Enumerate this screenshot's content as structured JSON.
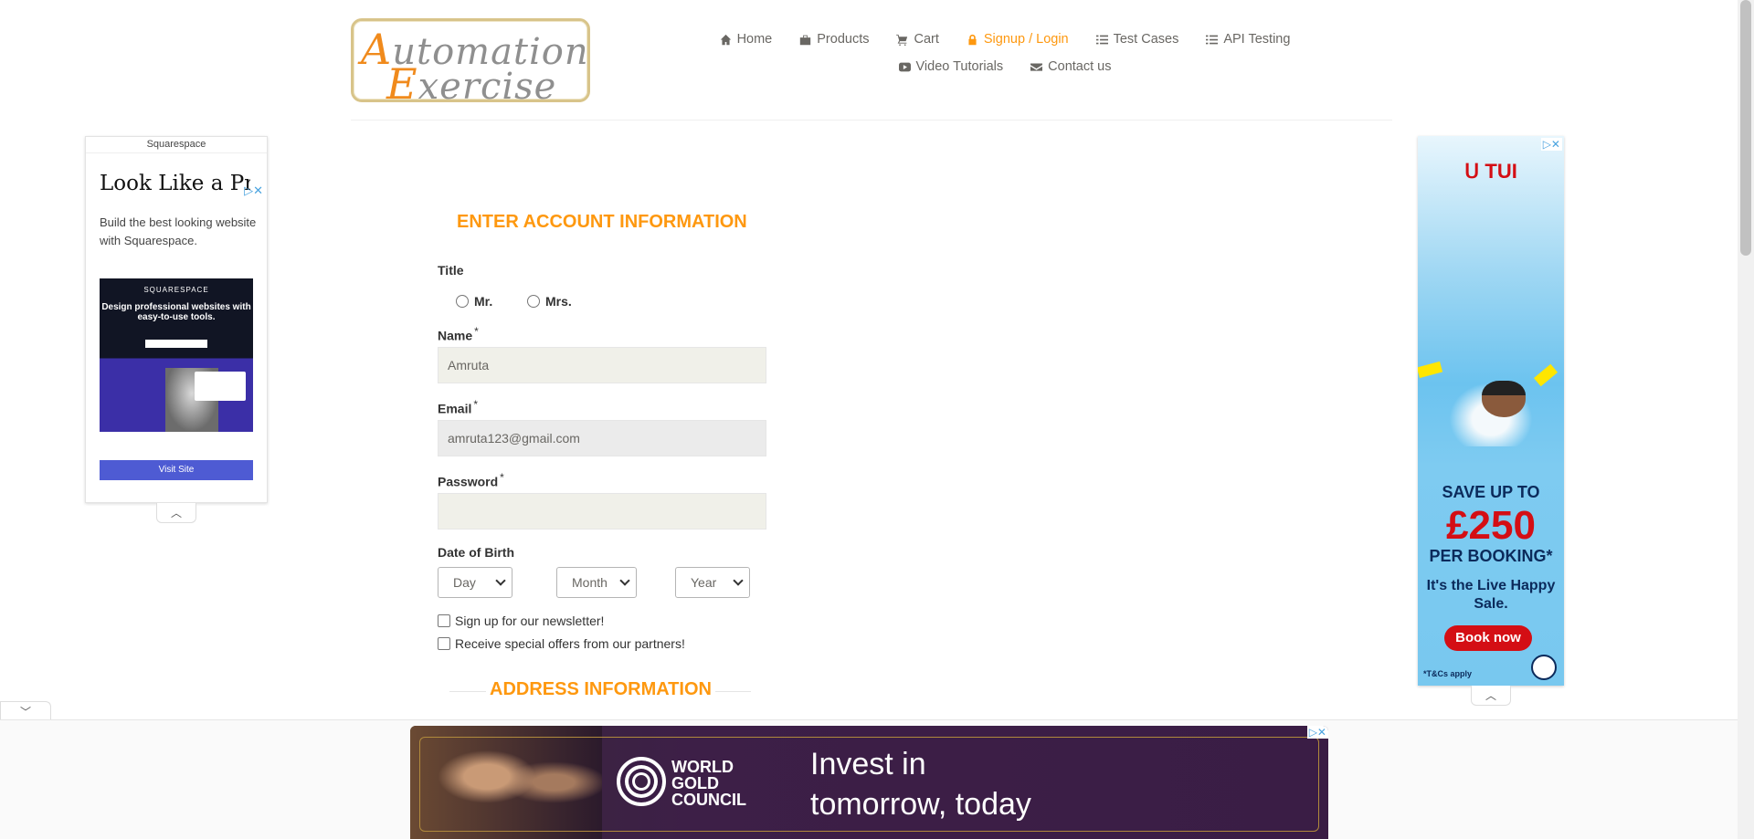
{
  "logo": {
    "line1": "Automation",
    "line2": "Exercise"
  },
  "nav": {
    "row1": [
      {
        "label": "Home",
        "icon": "home-icon"
      },
      {
        "label": "Products",
        "icon": "products-icon"
      },
      {
        "label": "Cart",
        "icon": "cart-icon"
      },
      {
        "label": "Signup / Login",
        "icon": "lock-icon",
        "active": true
      },
      {
        "label": "Test Cases",
        "icon": "list-icon"
      },
      {
        "label": "API Testing",
        "icon": "list-icon"
      }
    ],
    "row2": [
      {
        "label": "Video Tutorials",
        "icon": "youtube-icon"
      },
      {
        "label": "Contact us",
        "icon": "envelope-icon"
      }
    ],
    "active_color": "#fe980f"
  },
  "ad_left": {
    "brand": "Squarespace",
    "headline": "Look Like a Pro",
    "description": "Build the best looking website with Squarespace.",
    "image_brand": "SQUARESPACE",
    "image_text": "Design professional websites with easy-to-use tools.",
    "cta": "Visit Site"
  },
  "ad_right": {
    "brand": "TUI",
    "save": "SAVE UP TO",
    "price": "£250",
    "per": "PER BOOKING*",
    "live": "It's the Live Happy Sale.",
    "cta": "Book now",
    "terms": "*T&Cs apply"
  },
  "form": {
    "heading": "ENTER ACCOUNT INFORMATION",
    "title_label": "Title",
    "title_options": [
      "Mr.",
      "Mrs."
    ],
    "name_label": "Name",
    "name_value": "Amruta",
    "email_label": "Email",
    "email_value": "amruta123@gmail.com",
    "password_label": "Password",
    "password_value": "",
    "required_mark": "*",
    "dob_label": "Date of Birth",
    "day": "Day",
    "month": "Month",
    "year": "Year",
    "newsletter": "Sign up for our newsletter!",
    "offers": "Receive special offers from our partners!",
    "address_heading": "ADDRESS INFORMATION"
  },
  "bottom_ad": {
    "brand_line1": "WORLD",
    "brand_line2": "GOLD",
    "brand_line3": "COUNCIL",
    "tagline_line1": "Invest in",
    "tagline_line2": "tomorrow, today"
  }
}
